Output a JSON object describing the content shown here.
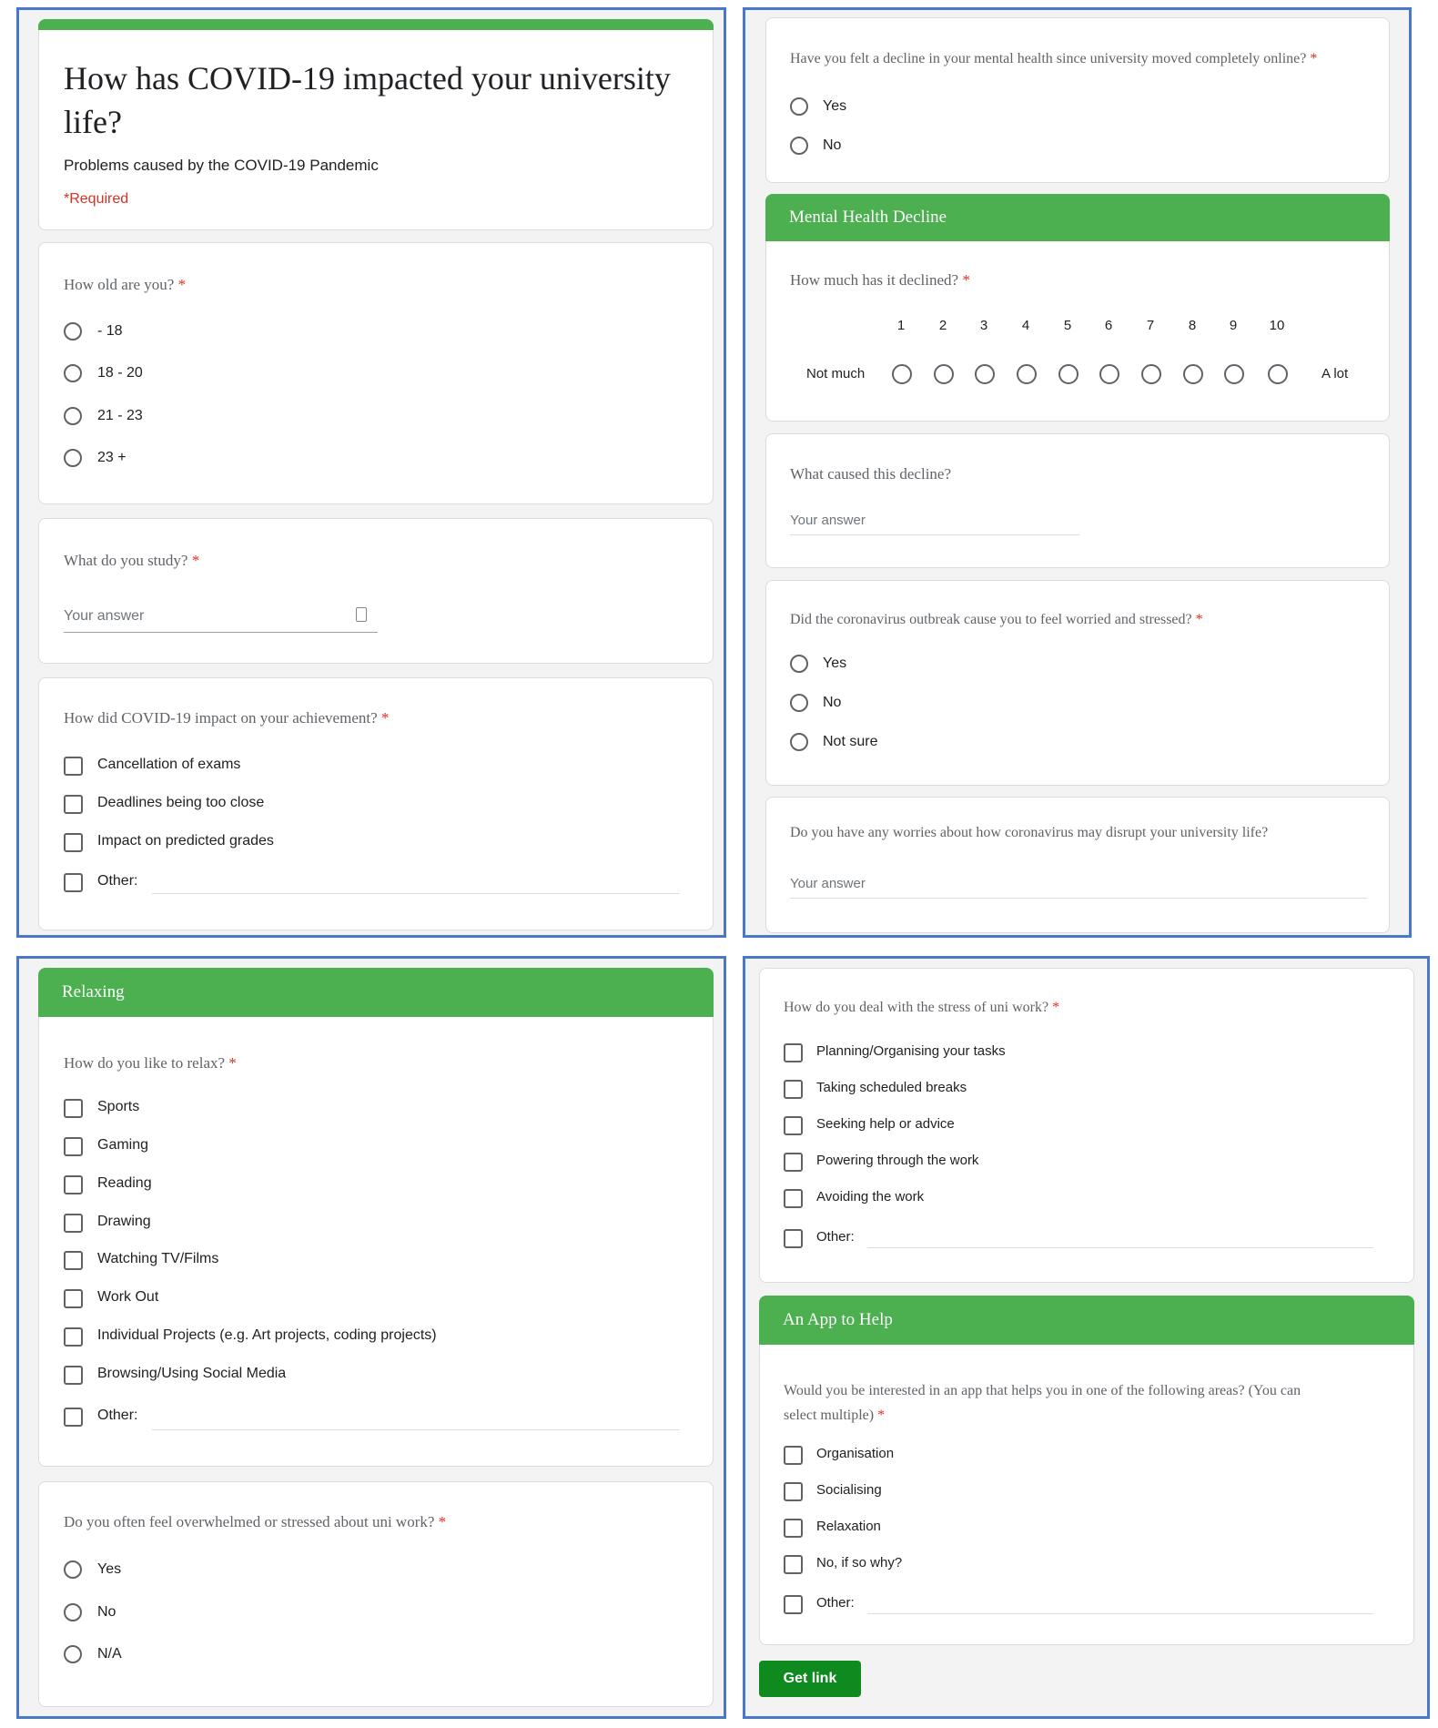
{
  "form": {
    "title": "How has COVID-19 impacted your university life?",
    "description": "Problems caused by the COVID-19 Pandemic",
    "required_note": "*Required"
  },
  "q_age": {
    "label": "How old are you?",
    "star": "*",
    "options": [
      "- 18",
      "18 - 20",
      "21 - 23",
      "23 +"
    ]
  },
  "q_study": {
    "label": "What do you study?",
    "star": "*",
    "placeholder": "Your answer"
  },
  "q_achievement": {
    "label": "How did COVID-19 impact on your achievement?",
    "star": "*",
    "options": [
      "Cancellation of exams",
      "Deadlines being too close",
      "Impact on predicted grades",
      "Other:"
    ]
  },
  "q_decline": {
    "label": "Have you felt a decline in your mental health since university moved completely online?",
    "star": "*",
    "options": [
      "Yes",
      "No"
    ]
  },
  "section_mental": {
    "title": "Mental Health Decline"
  },
  "q_how_much": {
    "label": "How much has it declined?",
    "star": "*",
    "scale": [
      "1",
      "2",
      "3",
      "4",
      "5",
      "6",
      "7",
      "8",
      "9",
      "10"
    ],
    "low_label": "Not much",
    "high_label": "A lot"
  },
  "q_cause": {
    "label": "What caused this decline?",
    "placeholder": "Your answer"
  },
  "q_worried": {
    "label": "Did the coronavirus outbreak cause you to feel worried and stressed?",
    "star": "*",
    "options": [
      "Yes",
      "No",
      "Not sure"
    ]
  },
  "q_worries": {
    "label": "Do you have any worries about how coronavirus may disrupt your university life?",
    "placeholder": "Your answer"
  },
  "section_relax": {
    "title": "Relaxing"
  },
  "q_relax": {
    "label": "How do you like to relax?",
    "star": "*",
    "options": [
      "Sports",
      "Gaming",
      "Reading",
      "Drawing",
      "Watching TV/Films",
      "Work Out",
      "Individual Projects (e.g. Art projects, coding projects)",
      "Browsing/Using Social Media",
      "Other:"
    ]
  },
  "q_overwhelmed": {
    "label": "Do you often feel overwhelmed or stressed about uni work?",
    "star": "*",
    "options": [
      "Yes",
      "No",
      "N/A"
    ]
  },
  "q_stress": {
    "label": "How do you deal with the stress of uni work?",
    "star": "*",
    "options": [
      "Planning/Organising your tasks",
      "Taking scheduled breaks",
      "Seeking help or advice",
      "Powering through the work",
      "Avoiding the work",
      "Other:"
    ]
  },
  "section_app": {
    "title": "An App to Help"
  },
  "q_app": {
    "label_line1": "Would you be interested in an app that helps you in one of the following areas? (You can",
    "label_line2": "select multiple)",
    "star": "*",
    "options": [
      "Organisation",
      "Socialising",
      "Relaxation",
      "No, if so why?",
      "Other:"
    ]
  },
  "actions": {
    "get_link": "Get link"
  },
  "colors": {
    "accent_green": "#4caf50",
    "panel_border": "#4a78c8",
    "required_red": "#d93025"
  }
}
